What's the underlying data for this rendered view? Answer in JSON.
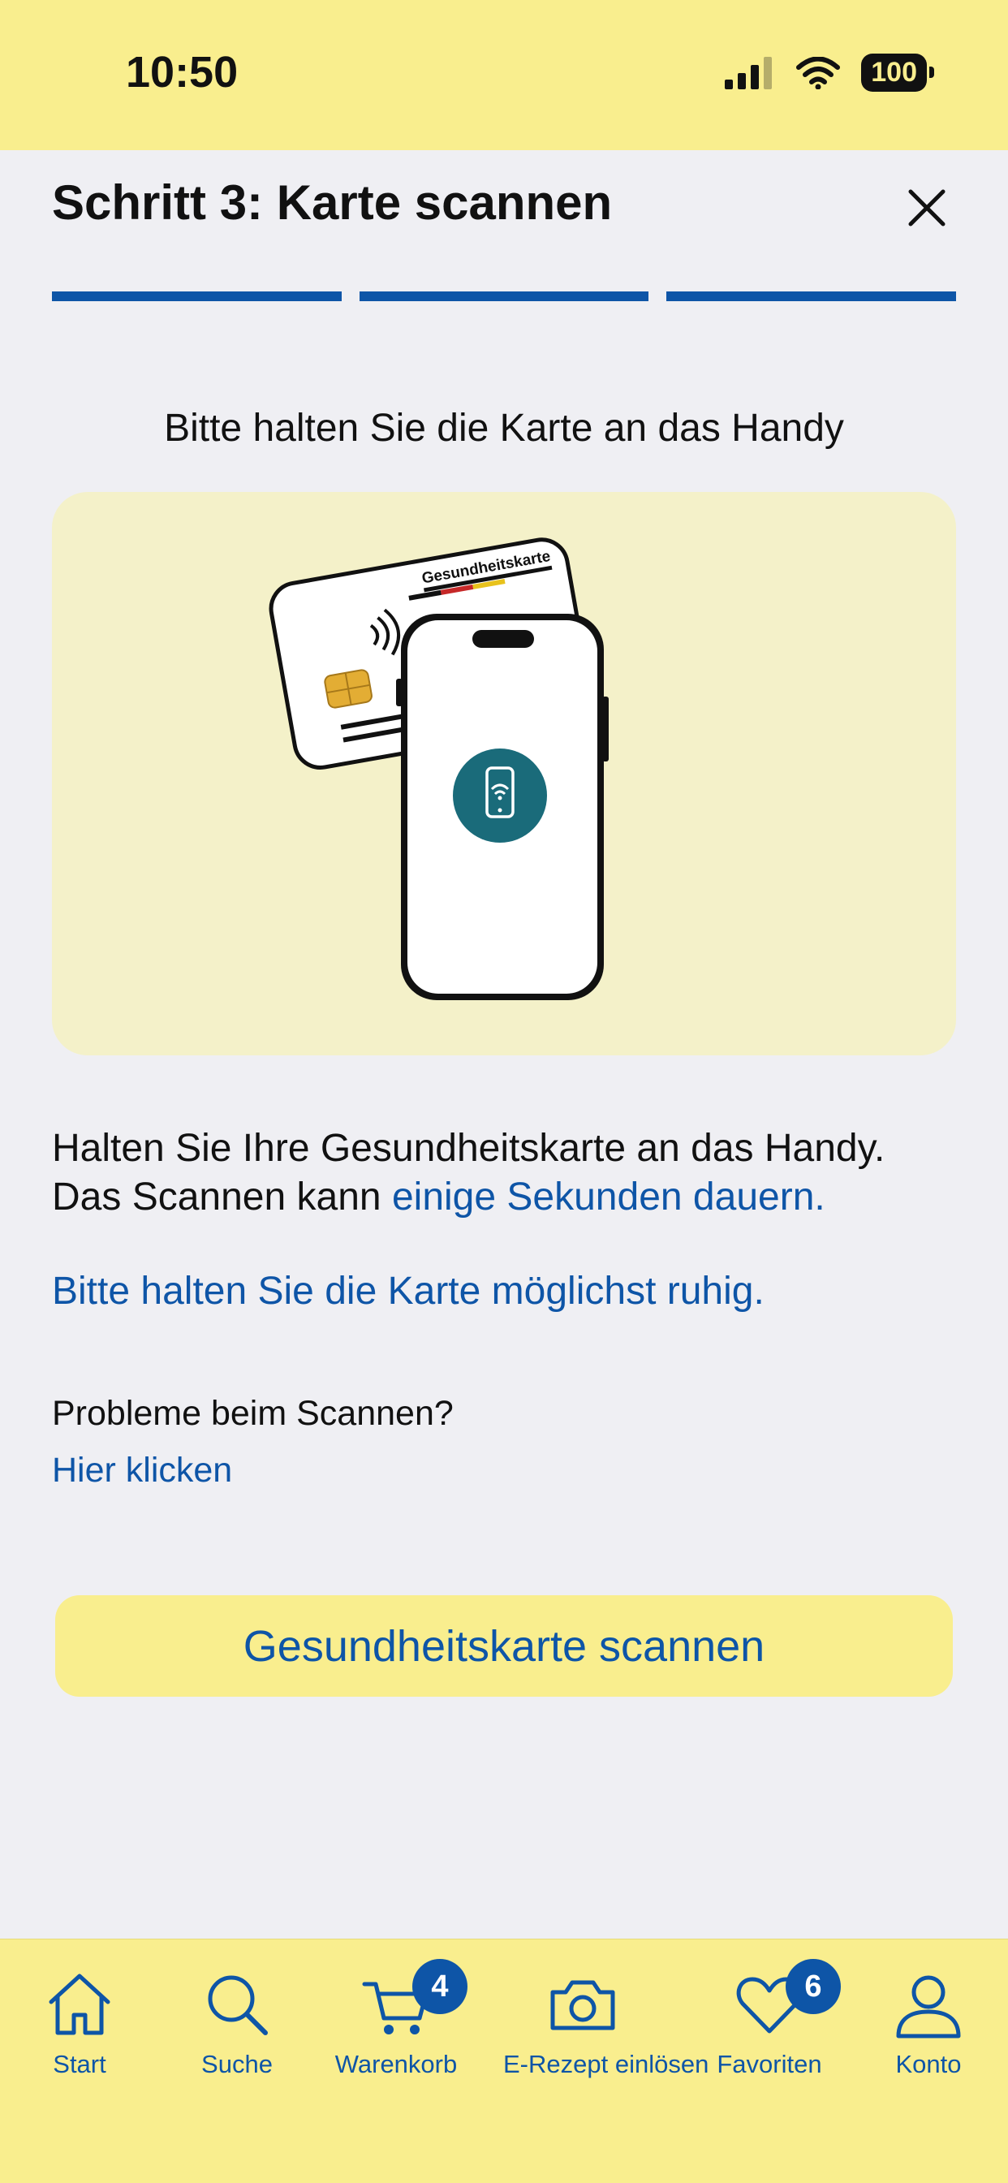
{
  "status_bar": {
    "time": "10:50",
    "battery": "100"
  },
  "header": {
    "title": "Schritt 3: Karte scannen"
  },
  "progress": {
    "steps_total": 3,
    "steps_completed": 3
  },
  "content": {
    "subtitle": "Bitte halten Sie die Karte an das Handy",
    "card_label": "Gesundheitskarte",
    "instruction_part1": "Halten Sie Ihre Gesundheitskarte an das Handy. Das Scannen kann ",
    "instruction_highlight": "einige Sekunden dauern.",
    "hold_still": "Bitte halten Sie die Karte möglichst ruhig.",
    "problem_question": "Probleme beim Scannen?",
    "problem_link": "Hier klicken",
    "scan_button": "Gesundheitskarte scannen"
  },
  "tab_bar": {
    "items": [
      {
        "label": "Start",
        "icon": "home-icon"
      },
      {
        "label": "Suche",
        "icon": "search-icon"
      },
      {
        "label": "Warenkorb",
        "icon": "cart-icon",
        "badge": "4"
      },
      {
        "label": "E-Rezept einlösen",
        "icon": "camera-icon"
      },
      {
        "label": "Favoriten",
        "icon": "heart-icon",
        "badge": "6"
      },
      {
        "label": "Konto",
        "icon": "person-icon"
      }
    ]
  },
  "colors": {
    "accent": "#0e55a7",
    "yellow": "#f9ee8e",
    "background": "#efeff3",
    "teal": "#1a6b7a"
  }
}
